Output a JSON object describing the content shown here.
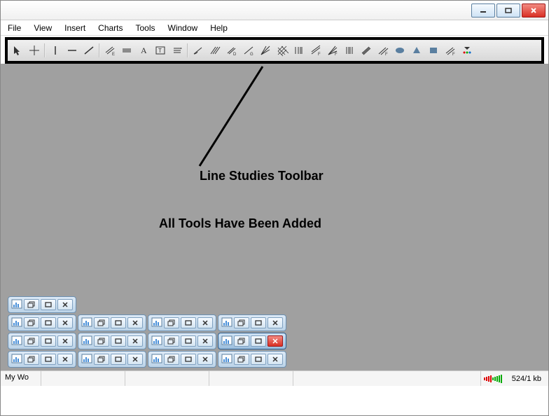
{
  "window": {
    "minimize_label": "Minimize",
    "maximize_label": "Maximize",
    "close_label": "Close"
  },
  "menu": {
    "file": "File",
    "view": "View",
    "insert": "Insert",
    "charts": "Charts",
    "tools": "Tools",
    "window": "Window",
    "help": "Help"
  },
  "toolbar_icons": [
    "cursor",
    "crosshair",
    "vertical-line",
    "horizontal-line",
    "trend-line",
    "equidistant-channel",
    "linear-regression",
    "text",
    "text-label",
    "arrows",
    "trend-by-angle",
    "andrews-pitchfork",
    "cycle-lines",
    "gann-line",
    "gann-fan",
    "gann-grid",
    "fibo-retracement",
    "fibo-time-zones",
    "fibo-fan",
    "fibo-arcs",
    "fibo-channel",
    "fibo-expansion",
    "ellipse",
    "triangle",
    "rectangle",
    "fibo-extend",
    "customize"
  ],
  "annotations": {
    "title": "Line Studies Toolbar",
    "subtitle": "All Tools Have Been Added"
  },
  "mdi": {
    "rows": [
      [
        1
      ],
      [
        1,
        1,
        1,
        1
      ],
      [
        1,
        1,
        1,
        2
      ],
      [
        1,
        1,
        1,
        1
      ]
    ]
  },
  "status": {
    "left": "My Wo",
    "kb": "524/1 kb"
  }
}
